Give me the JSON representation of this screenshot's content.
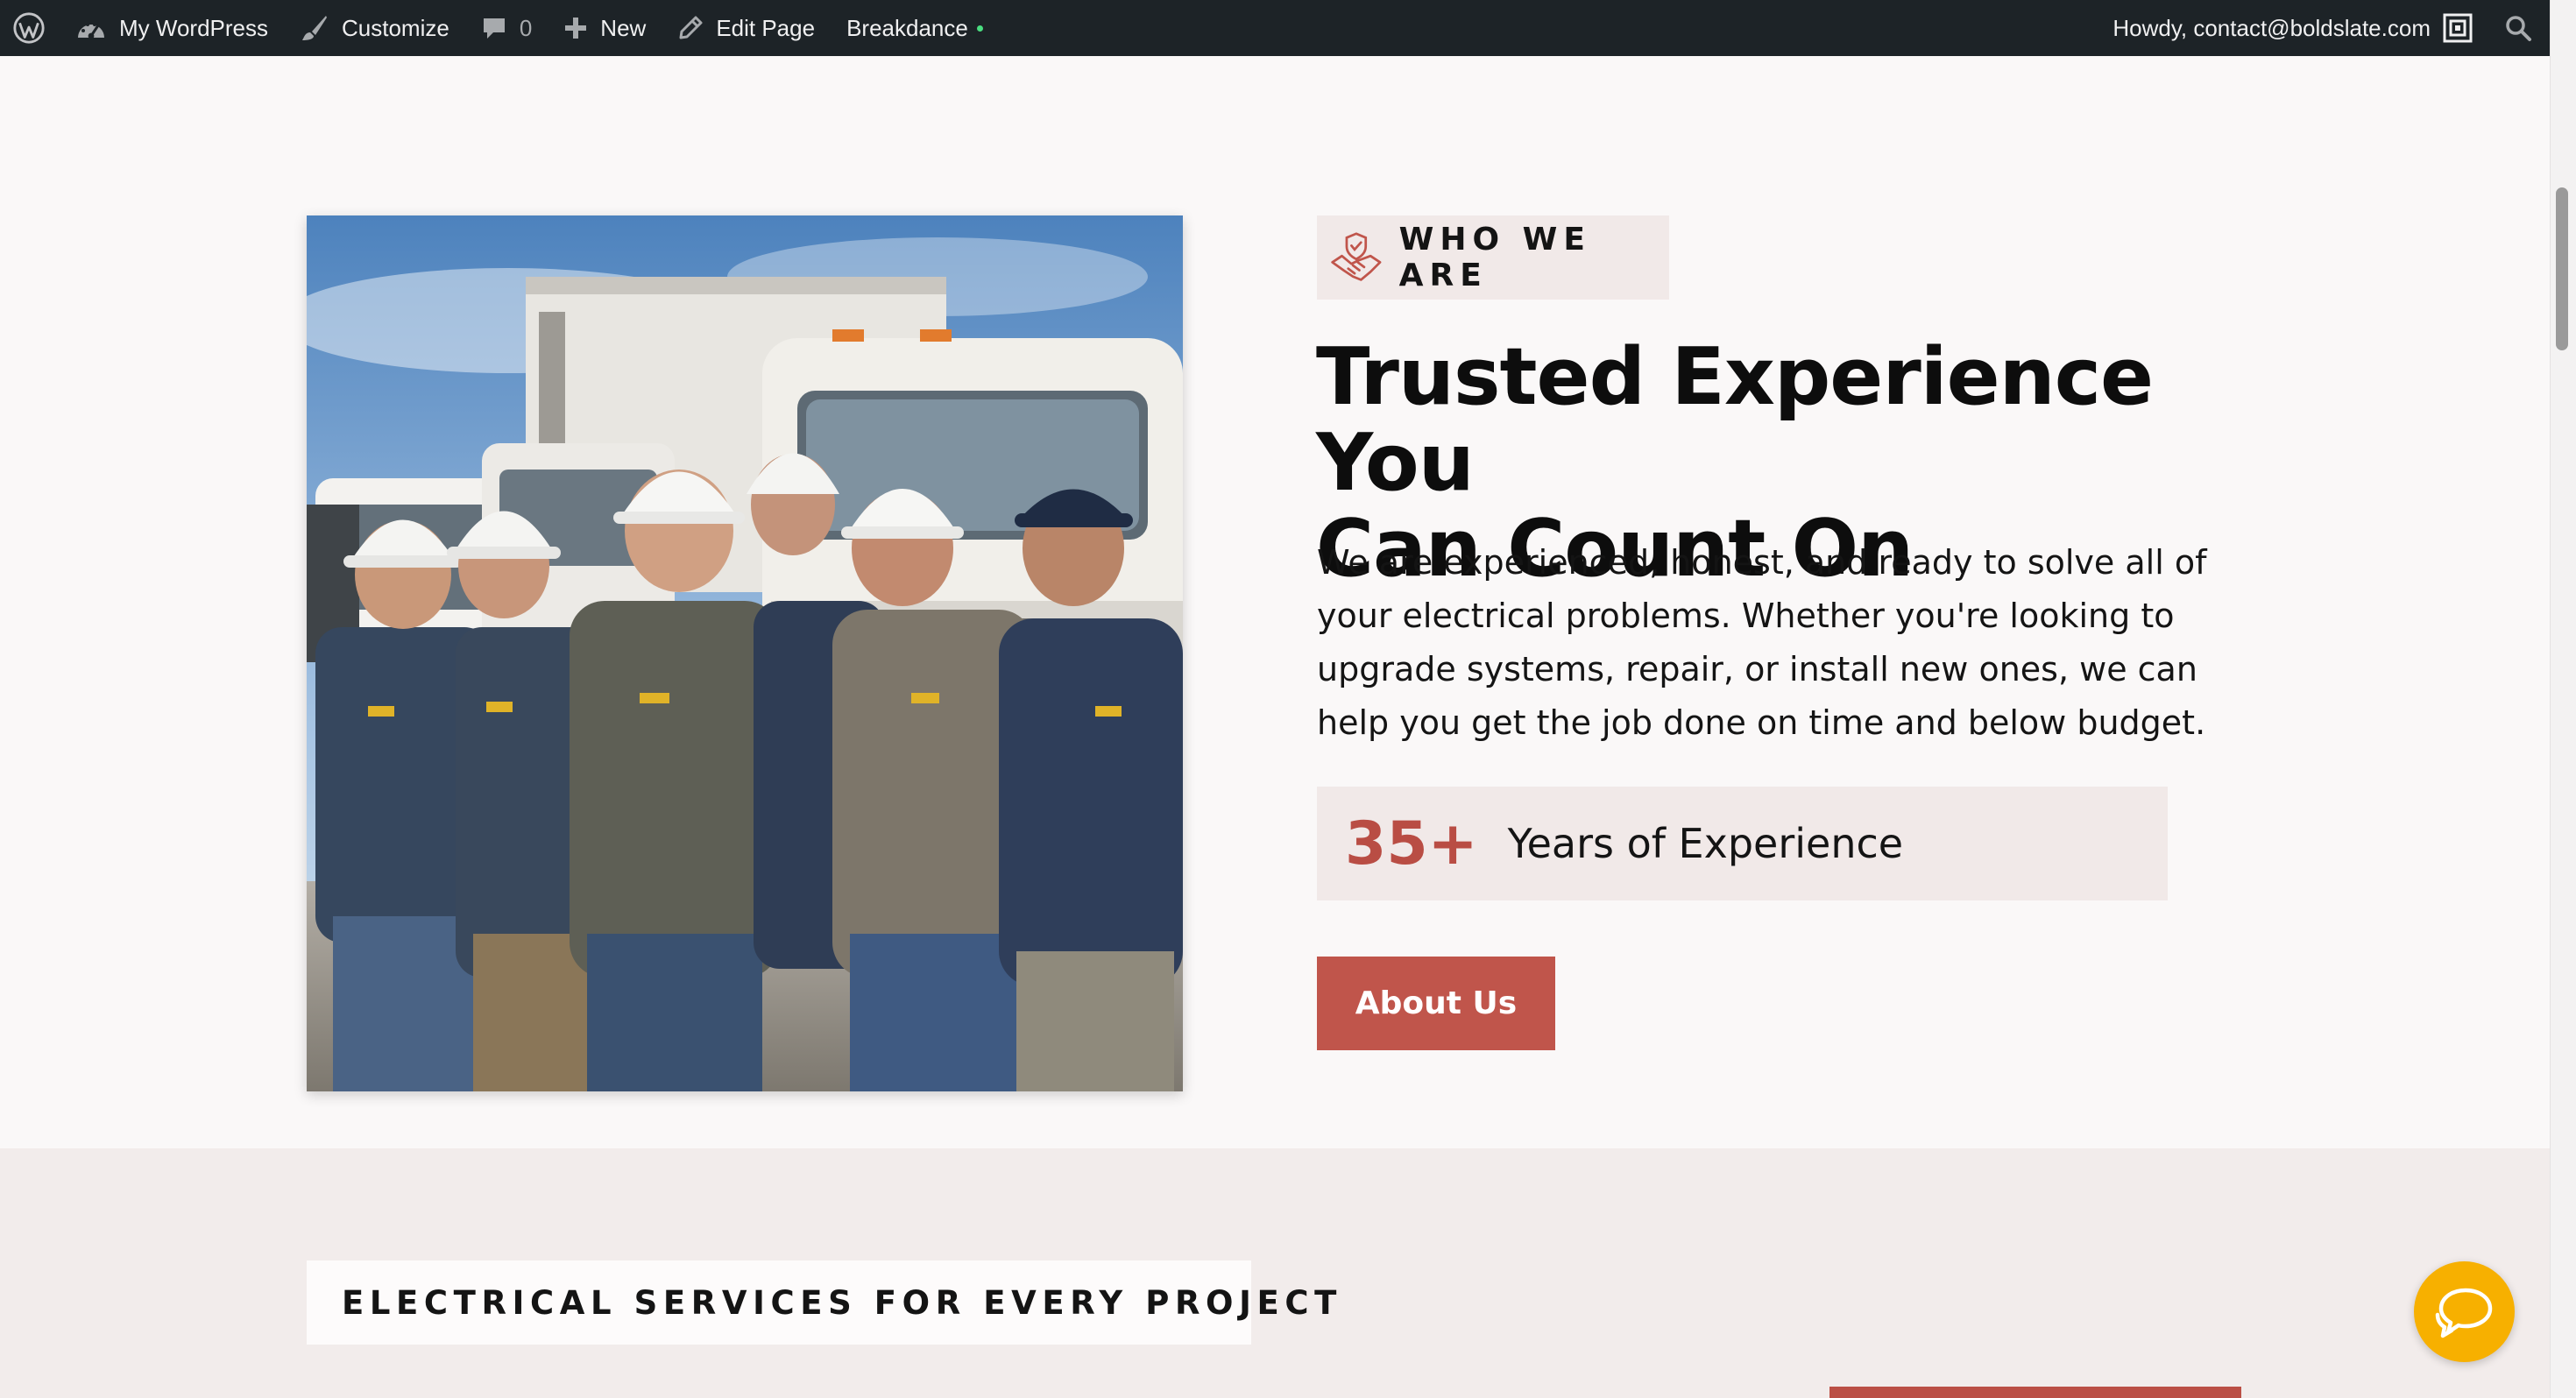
{
  "admin_bar": {
    "site_name": "My WordPress",
    "customize": "Customize",
    "comments_count": "0",
    "new": "New",
    "edit_page": "Edit Page",
    "breakdance": "Breakdance",
    "howdy": "Howdy, contact@boldslate.com",
    "icons": [
      "wordpress-logo-icon",
      "dashboard-icon",
      "paintbrush-icon",
      "comment-bubble-icon",
      "plus-icon",
      "pencil-icon",
      "avatar-icon",
      "search-icon"
    ]
  },
  "about": {
    "image_alt": "Team of electricians in hard hats standing in front of service trucks",
    "badge": "WHO WE ARE",
    "badge_icon": "handshake-shield-icon",
    "headline_line1": "Trusted Experience You",
    "headline_line2": "Can Count On",
    "description": "We are experienced, honest, and ready to solve all of your electrical problems. Whether you're looking to upgrade systems, repair, or install new ones, we can help you get the job done on time and below budget.",
    "stat_value": "35+",
    "stat_label": "Years of Experience",
    "button": "About Us"
  },
  "services": {
    "badge": "ELECTRICAL SERVICES FOR EVERY PROJECT",
    "badge_icon": "award-ribbon-bolt-icon"
  },
  "chat": {
    "icon": "chat-bubbles-icon"
  },
  "colors": {
    "admin_bg": "#1d2327",
    "accent": "#c0554b",
    "badge_bg": "#f1e9e8",
    "section_alt_bg": "#f2eceb",
    "chat": "#f7b000"
  }
}
